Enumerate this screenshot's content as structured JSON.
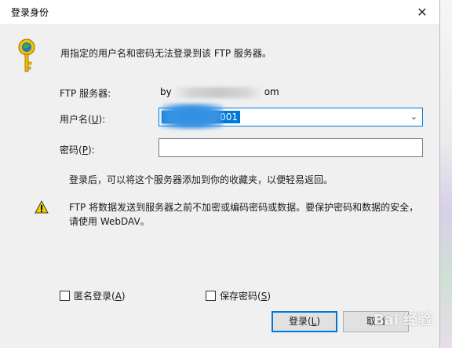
{
  "dialog": {
    "title": "登录身份",
    "close_glyph": "✕",
    "header_message": "用指定的用户名和密码无法登录到该 FTP 服务器。",
    "server_label": "FTP 服务器:",
    "server_value_start": "by",
    "server_value_end": "om",
    "username_label_pre": "用户名(",
    "username_label_key": "U",
    "username_label_post": "):",
    "username_value": "001",
    "password_label_pre": "密码(",
    "password_label_key": "P",
    "password_label_post": "):",
    "password_value": "",
    "info_text": "登录后，可以将这个服务器添加到你的收藏夹，以便轻易返回。",
    "warning_text": "FTP 将数据发送到服务器之前不加密或编码密码或数据。要保护密码和数据的安全，请使用 WebDAV。",
    "anonymous_label_pre": "匿名登录(",
    "anonymous_label_key": "A",
    "anonymous_label_post": ")",
    "save_password_label_pre": "保存密码(",
    "save_password_label_key": "S",
    "save_password_label_post": ")",
    "login_button_pre": "登录(",
    "login_button_key": "L",
    "login_button_post": ")",
    "cancel_button": "取消"
  },
  "watermark": "Bai 经验",
  "colors": {
    "accent": "#0078d7",
    "warning": "#f5d000"
  },
  "icons": [
    "key-icon",
    "warning-icon",
    "chevron-down-icon",
    "close-icon"
  ]
}
